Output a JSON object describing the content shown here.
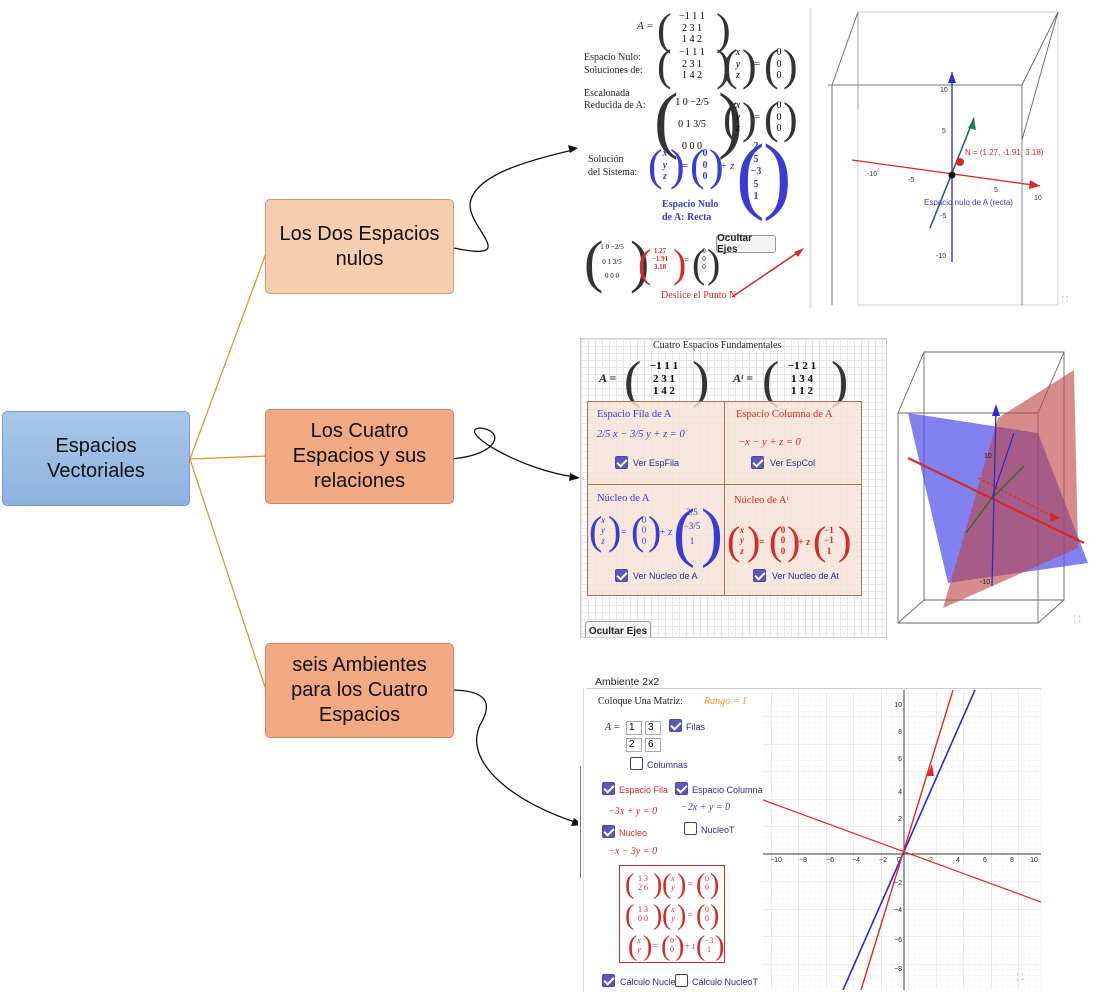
{
  "mindmap": {
    "root": "Espacios Vectoriales",
    "branch1": "Los Dos Espacios nulos",
    "branch2": "Los Cuatro Espacios y sus relaciones",
    "branch3": "seis Ambientes para los Cuatro Espacios"
  },
  "colors": {
    "root_fill": "#9dbde6",
    "branch1_fill": "#f7cdb0",
    "branch23_fill": "#f4a985",
    "connector": "#d9992c",
    "blue_math": "#3a3ad6",
    "red_math": "#d42a2a"
  },
  "panel1": {
    "matrix_A_label": "A =",
    "matrix_A": [
      "−1  1  1",
      "2  3  1",
      "1  4  2"
    ],
    "espacio_nulo": "Espacio Nulo:",
    "soluciones_de": "Soluciones de:",
    "escalonada": "Escalonada",
    "reducida": "Reducida de A:",
    "rref": [
      "1  0  −2/5",
      "0  1  3/5",
      "0  0  0"
    ],
    "vars": [
      "x",
      "y",
      "z"
    ],
    "zeros": [
      "0",
      "0",
      "0"
    ],
    "solucion": "Solución",
    "del_sistema": "del Sistema:",
    "direction": [
      "2",
      "5",
      "−3",
      "5",
      "1"
    ],
    "espacio_nulo_recta_1": "Espacio Nulo",
    "espacio_nulo_recta_2": "de A: Recta",
    "ocultar_ejes": "Ocultar Ejes",
    "point_vec": [
      "1.27",
      "−1.91",
      "3.18"
    ],
    "deslice": "Deslice el Punto N",
    "point_label": "N = (1.27, -1.91, 3.18)",
    "line_label": "Espacio nulo de A (recta)",
    "axis_ticks": [
      "10",
      "5",
      "-10",
      "-5",
      "5",
      "10",
      "-5",
      "-10"
    ]
  },
  "panel2": {
    "title": "Cuatro Espacios Fundamentales",
    "A_label": "A =",
    "At_label": "Aᵗ =",
    "A": [
      "−1  1  1",
      "2  3  1",
      "1  4  2"
    ],
    "At": [
      "−1  2  1",
      "1  3  4",
      "1  1  2"
    ],
    "fila_title": "Espacio Fila de A",
    "fila_eq": "2/5 x − 3/5 y + z = 0",
    "fila_check": "Ver EspFila",
    "col_title": "Espacio Columna de A",
    "col_eq": "−x − y + z = 0",
    "col_check": "Ver EspCol",
    "nucleo_title": "Núcleo de A",
    "nucleo_check": "Ver Nucleo de A",
    "nucleoT_title": "Núcleo de Aᵗ",
    "nucleoT_check": "Ver Nucleo de At",
    "ocultar_ejes": "Ocultar Ejes",
    "nucleo_vec": [
      "2/5",
      "−3/5",
      "1"
    ],
    "nucleoT_vec": [
      "−1",
      "−1",
      "1"
    ],
    "tick_labels": [
      "10",
      "-10"
    ]
  },
  "panel3": {
    "header": "Ambiente 2x2",
    "coloque": "Coloque Una Matriz:",
    "rango": "Rango = 1",
    "A_label": "A =",
    "matrix_inputs": [
      "1",
      "3",
      "2",
      "6"
    ],
    "filas": "Filas",
    "columnas": "Columnas",
    "espacio_fila": "Espacio Fila",
    "espacio_columna": "Espacio Columna",
    "eq_fila": "−3x + y = 0",
    "eq_col": "−2x + y = 0",
    "nucleo": "Nucleo",
    "nucleoT": "NucleoT",
    "eq_nucleo": "−x − 3y = 0",
    "sys1_matrix": [
      "1  3",
      "2  6"
    ],
    "sys2_matrix": [
      "1  3",
      "0  0"
    ],
    "sol_dir": [
      "−3",
      "1"
    ],
    "calc_nucleo": "Cálculo Nucleo",
    "calc_nucleoT": "Cálculo NucleoT",
    "x_ticks": [
      "−10",
      "−8",
      "−6",
      "−4",
      "−2",
      "0",
      "2",
      "4",
      "6",
      "8",
      "10"
    ],
    "y_ticks": [
      "10",
      "8",
      "6",
      "4",
      "2",
      "−2",
      "−4",
      "−6",
      "−8"
    ]
  }
}
